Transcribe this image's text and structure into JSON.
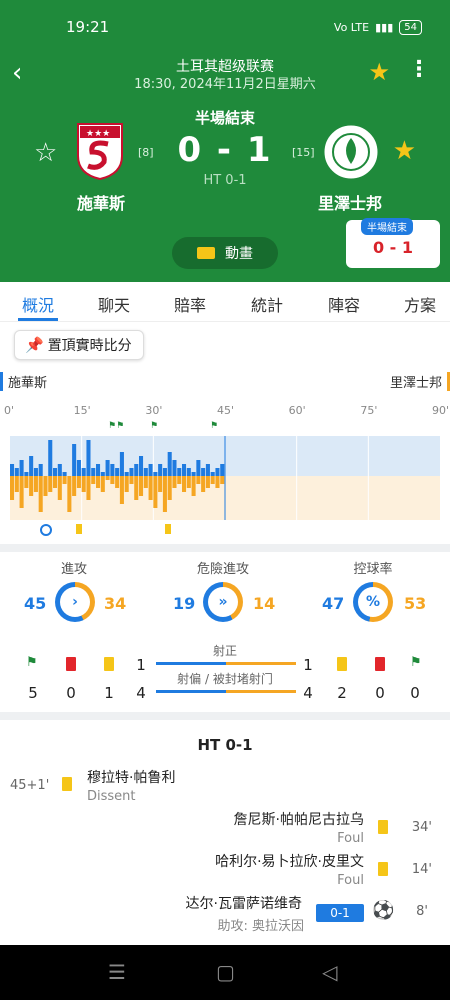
{
  "status_bar": {
    "time": "19:21",
    "network": "Vo LTE",
    "battery": "54"
  },
  "header": {
    "league": "土耳其超级联赛",
    "datetime": "18:30, 2024年11月2日星期六",
    "match_status": "半場結束",
    "score": "0 - 1",
    "ht_score": "HT 0-1",
    "home": {
      "name": "施華斯",
      "rank": "[8]"
    },
    "away": {
      "name": "里澤士邦",
      "rank": "[15]"
    },
    "animation_label": "動畫",
    "mini_widget": {
      "badge": "半場結束",
      "score": "0 - 1"
    }
  },
  "tabs": [
    "概況",
    "聊天",
    "賠率",
    "統計",
    "陣容",
    "方案"
  ],
  "pin_button": "置頂實時比分",
  "teams_row": {
    "home": "施華斯",
    "away": "里澤士邦"
  },
  "timeline": {
    "ticks": [
      "0'",
      "15'",
      "30'",
      "45'",
      "60'",
      "75'",
      "90'"
    ],
    "current_minute": 45,
    "home_attack": [
      0.3,
      0.2,
      0.4,
      0.1,
      0.5,
      0.2,
      0.3,
      0.0,
      0.9,
      0.2,
      0.3,
      0.1,
      0.0,
      0.8,
      0.4,
      0.2,
      0.9,
      0.2,
      0.3,
      0.1,
      0.4,
      0.3,
      0.2,
      0.6,
      0.1,
      0.2,
      0.3,
      0.5,
      0.2,
      0.3,
      0.1,
      0.3,
      0.2,
      0.6,
      0.4,
      0.2,
      0.3,
      0.2,
      0.1,
      0.4,
      0.2,
      0.3,
      0.1,
      0.2,
      0.3
    ],
    "away_attack": [
      0.6,
      0.4,
      0.8,
      0.3,
      0.5,
      0.4,
      0.9,
      0.5,
      0.4,
      0.3,
      0.6,
      0.2,
      0.9,
      0.5,
      0.3,
      0.4,
      0.6,
      0.2,
      0.3,
      0.4,
      0.1,
      0.2,
      0.3,
      0.7,
      0.4,
      0.2,
      0.6,
      0.5,
      0.3,
      0.6,
      0.8,
      0.4,
      0.9,
      0.6,
      0.3,
      0.2,
      0.4,
      0.3,
      0.5,
      0.2,
      0.4,
      0.3,
      0.2,
      0.3,
      0.2
    ]
  },
  "stats": {
    "attack": {
      "label": "進攻",
      "home": "45",
      "away": "34"
    },
    "dangerous": {
      "label": "危險進攻",
      "home": "19",
      "away": "14"
    },
    "possession": {
      "label": "控球率",
      "home": "47",
      "away": "53",
      "symbol": "%"
    },
    "on_target": {
      "label": "射正",
      "home": "1",
      "away": "1"
    },
    "off_target": {
      "label": "射偏 / 被封堵射门",
      "home": "4",
      "away": "4"
    },
    "home_corners": "5",
    "home_red": "0",
    "home_yellow": "1",
    "away_yellow": "2",
    "away_red": "0",
    "away_corners": "0"
  },
  "events_title": "HT 0-1",
  "events": [
    {
      "time": "45+1'",
      "player": "穆拉特·帕鲁利",
      "detail": "Dissent"
    },
    {
      "time": "34'",
      "player": "詹尼斯·帕帕尼古拉乌",
      "detail": "Foul"
    },
    {
      "time": "14'",
      "player": "哈利尔·易卜拉欣·皮里文",
      "detail": "Foul"
    },
    {
      "time": "8'",
      "player": "达尔·瓦雷萨诺维奇",
      "detail": "助攻: 奥拉沃因",
      "score": "0-1"
    }
  ],
  "colors": {
    "green": "#1f8a3b",
    "blue": "#1f7be0",
    "orange": "#f5a623",
    "yellow": "#f5c518"
  }
}
